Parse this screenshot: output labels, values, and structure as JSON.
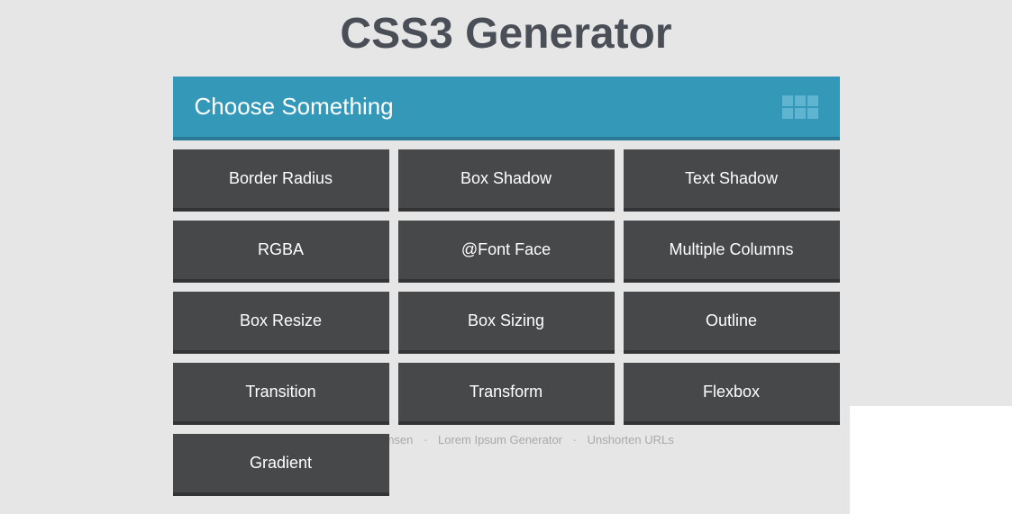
{
  "title": "CSS3 Generator",
  "header": {
    "label": "Choose Something"
  },
  "options": [
    "Border Radius",
    "Box Shadow",
    "Text Shadow",
    "RGBA",
    "@Font Face",
    "Multiple Columns",
    "Box Resize",
    "Box Sizing",
    "Outline",
    "Transition",
    "Transform",
    "Flexbox",
    "Gradient"
  ],
  "footer": {
    "link1": "Randy Jensen",
    "link2": "Lorem Ipsum Generator",
    "link3": "Unshorten URLs"
  }
}
